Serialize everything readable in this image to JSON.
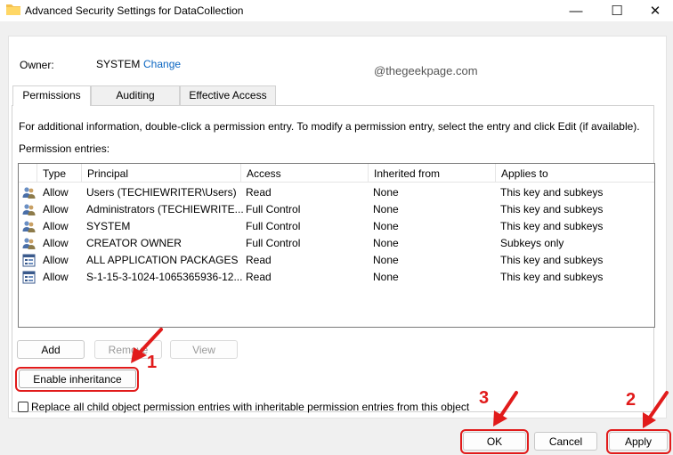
{
  "window": {
    "title": "Advanced Security Settings for DataCollection",
    "minimize": "—",
    "maximize": "☐",
    "close": "✕"
  },
  "owner": {
    "label": "Owner:",
    "value": "SYSTEM",
    "change_link": "Change"
  },
  "watermark": "@thegeekpage.com",
  "tabs": [
    {
      "label": "Permissions",
      "active": true
    },
    {
      "label": "Auditing",
      "active": false
    },
    {
      "label": "Effective Access",
      "active": false
    }
  ],
  "info_text": "For additional information, double-click a permission entry. To modify a permission entry, select the entry and click Edit (if available).",
  "entries_label": "Permission entries:",
  "columns": [
    "Type",
    "Principal",
    "Access",
    "Inherited from",
    "Applies to"
  ],
  "rows": [
    {
      "icon": "users-group-icon",
      "type": "Allow",
      "principal": "Users (TECHIEWRITER\\Users)",
      "access": "Read",
      "inherited": "None",
      "applies": "This key and subkeys"
    },
    {
      "icon": "users-group-icon",
      "type": "Allow",
      "principal": "Administrators (TECHIEWRITE...",
      "access": "Full Control",
      "inherited": "None",
      "applies": "This key and subkeys"
    },
    {
      "icon": "users-group-icon",
      "type": "Allow",
      "principal": "SYSTEM",
      "access": "Full Control",
      "inherited": "None",
      "applies": "This key and subkeys"
    },
    {
      "icon": "users-group-icon",
      "type": "Allow",
      "principal": "CREATOR OWNER",
      "access": "Full Control",
      "inherited": "None",
      "applies": "Subkeys only"
    },
    {
      "icon": "app-package-icon",
      "type": "Allow",
      "principal": "ALL APPLICATION PACKAGES",
      "access": "Read",
      "inherited": "None",
      "applies": "This key and subkeys"
    },
    {
      "icon": "app-package-icon",
      "type": "Allow",
      "principal": "S-1-15-3-1024-1065365936-12...",
      "access": "Read",
      "inherited": "None",
      "applies": "This key and subkeys"
    }
  ],
  "buttons": {
    "add": "Add",
    "remove": "Remove",
    "view": "View",
    "enable_inheritance": "Enable inheritance",
    "ok": "OK",
    "cancel": "Cancel",
    "apply": "Apply"
  },
  "replace_checkbox": {
    "label": "Replace all child object permission entries with inheritable permission entries from this object",
    "checked": false
  },
  "annotations": {
    "step1": "1",
    "step2": "2",
    "step3": "3",
    "color": "#e11b1b"
  }
}
